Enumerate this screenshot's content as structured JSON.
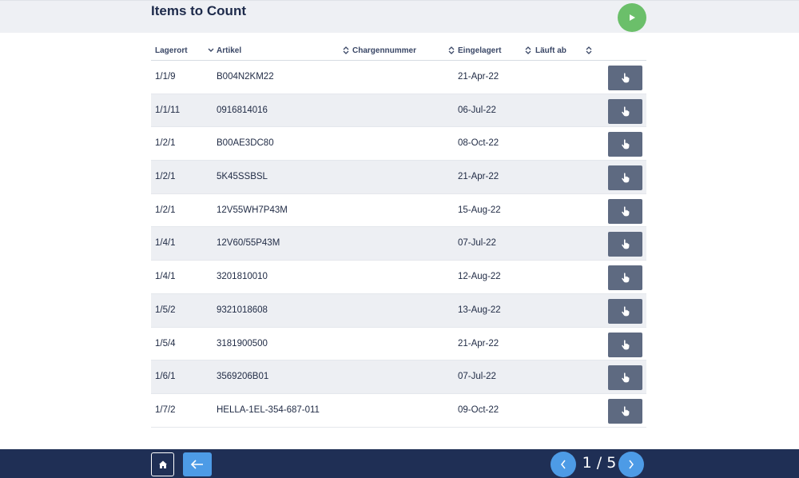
{
  "header": {
    "title": "Items to Count"
  },
  "table": {
    "columns": [
      "Lagerort",
      "Artikel",
      "Chargennummer",
      "Eingelagert",
      "Läuft ab"
    ],
    "rows": [
      {
        "lagerort": "1/1/9",
        "artikel": "B004N2KM22",
        "charge": "",
        "eingelagert": "21-Apr-22",
        "laeuft_ab": ""
      },
      {
        "lagerort": "1/1/11",
        "artikel": "0916814016",
        "charge": "",
        "eingelagert": "06-Jul-22",
        "laeuft_ab": ""
      },
      {
        "lagerort": "1/2/1",
        "artikel": "B00AE3DC80",
        "charge": "",
        "eingelagert": "08-Oct-22",
        "laeuft_ab": ""
      },
      {
        "lagerort": "1/2/1",
        "artikel": "5K45SSBSL",
        "charge": "",
        "eingelagert": "21-Apr-22",
        "laeuft_ab": ""
      },
      {
        "lagerort": "1/2/1",
        "artikel": "12V55WH7P43M",
        "charge": "",
        "eingelagert": "15-Aug-22",
        "laeuft_ab": ""
      },
      {
        "lagerort": "1/4/1",
        "artikel": "12V60/55P43M",
        "charge": "",
        "eingelagert": "07-Jul-22",
        "laeuft_ab": ""
      },
      {
        "lagerort": "1/4/1",
        "artikel": "3201810010",
        "charge": "",
        "eingelagert": "12-Aug-22",
        "laeuft_ab": ""
      },
      {
        "lagerort": "1/5/2",
        "artikel": "9321018608",
        "charge": "",
        "eingelagert": "13-Aug-22",
        "laeuft_ab": ""
      },
      {
        "lagerort": "1/5/4",
        "artikel": "3181900500",
        "charge": "",
        "eingelagert": "21-Apr-22",
        "laeuft_ab": ""
      },
      {
        "lagerort": "1/6/1",
        "artikel": "3569206B01",
        "charge": "",
        "eingelagert": "07-Jul-22",
        "laeuft_ab": ""
      },
      {
        "lagerort": "1/7/2",
        "artikel": "HELLA-1EL-354-687-011",
        "charge": "",
        "eingelagert": "09-Oct-22",
        "laeuft_ab": ""
      }
    ]
  },
  "footer": {
    "page_indicator": "1 / 5"
  },
  "icons": {
    "play": "play-icon",
    "sort": "sort-icon",
    "sort_down": "chevron-down-icon",
    "row_action": "hand-pointer-icon",
    "home": "home-icon",
    "back": "arrow-left-icon",
    "prev": "chevron-left-icon",
    "next": "chevron-right-icon"
  },
  "colors": {
    "play_button": "#6bbf6a",
    "row_button": "#5e6a81",
    "footer_bg": "#1f2f55",
    "nav_blue": "#4d9be6"
  }
}
